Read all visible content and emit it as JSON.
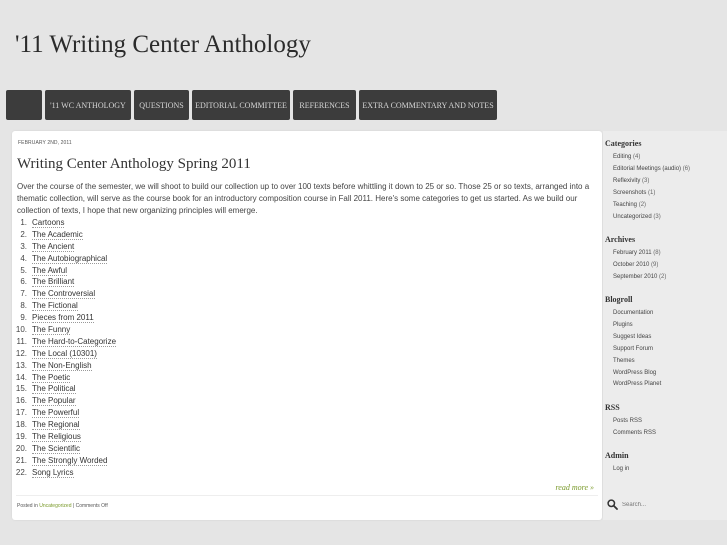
{
  "site": {
    "title": "'11 Writing Center Anthology"
  },
  "nav": {
    "home_label": "",
    "items": [
      "'11 WC Anthology",
      "Questions",
      "Editorial Committee",
      "References",
      "Extra Commentary and Notes"
    ]
  },
  "post": {
    "date": "February 2nd, 2011",
    "title": "Writing Center Anthology Spring 2011",
    "intro": "Over the course of the semester, we will shoot to build our collection up to over 100 texts before whittling it down to 25 or so. Those 25 or so texts, arranged into a thematic collection, will serve as the course book for an introductory composition course in Fall 2011. Here's some categories to get us started. As we build our collection of texts, I hope that new organizing principles will emerge.",
    "list": [
      {
        "num": "1.",
        "label": "Cartoons"
      },
      {
        "num": "2.",
        "label": "The Academic"
      },
      {
        "num": "3.",
        "label": "The Ancient"
      },
      {
        "num": "4.",
        "label": "The Autobiographical"
      },
      {
        "num": "5.",
        "label": "The Awful"
      },
      {
        "num": "6.",
        "label": "The Brilliant"
      },
      {
        "num": "7.",
        "label": "The Controversial"
      },
      {
        "num": "8.",
        "label": "The Fictional"
      },
      {
        "num": "9.",
        "label": "Pieces from 2011"
      },
      {
        "num": "10.",
        "label": "The Funny"
      },
      {
        "num": "11.",
        "label": "The Hard-to-Categorize"
      },
      {
        "num": "12.",
        "label": "The Local (10301)"
      },
      {
        "num": "13.",
        "label": "The Non-English"
      },
      {
        "num": "14.",
        "label": "The Poetic"
      },
      {
        "num": "15.",
        "label": "The Political"
      },
      {
        "num": "16.",
        "label": "The Popular"
      },
      {
        "num": "17.",
        "label": "The Powerful"
      },
      {
        "num": "18.",
        "label": "The Regional"
      },
      {
        "num": "19.",
        "label": "The Religious"
      },
      {
        "num": "20.",
        "label": "The Scientific"
      },
      {
        "num": "21.",
        "label": "The Strongly Worded"
      },
      {
        "num": "22.",
        "label": "Song Lyrics"
      }
    ],
    "read_more": "read more »",
    "meta_prefix": "Posted in ",
    "meta_category": "Uncategorized",
    "meta_suffix": " | Comments Off"
  },
  "sidebar": {
    "categories_title": "Categories",
    "categories": [
      {
        "label": "Editing",
        "count": "(4)"
      },
      {
        "label": "Editorial Meetings (audio)",
        "count": "(6)"
      },
      {
        "label": "Reflexivity",
        "count": "(3)"
      },
      {
        "label": "Screenshots",
        "count": "(1)"
      },
      {
        "label": "Teaching",
        "count": "(2)"
      },
      {
        "label": "Uncategorized",
        "count": "(3)"
      }
    ],
    "archives_title": "Archives",
    "archives": [
      {
        "label": "February 2011",
        "count": "(8)"
      },
      {
        "label": "October 2010",
        "count": "(9)"
      },
      {
        "label": "September 2010",
        "count": "(2)"
      }
    ],
    "blogroll_title": "Blogroll",
    "blogroll": [
      "Documentation",
      "Plugins",
      "Suggest Ideas",
      "Support Forum",
      "Themes",
      "WordPress Blog",
      "WordPress Planet"
    ],
    "rss_title": "RSS",
    "rss": [
      "Posts RSS",
      "Comments RSS"
    ],
    "admin_title": "Admin",
    "admin": [
      "Log in"
    ],
    "search_placeholder": "Search..."
  }
}
